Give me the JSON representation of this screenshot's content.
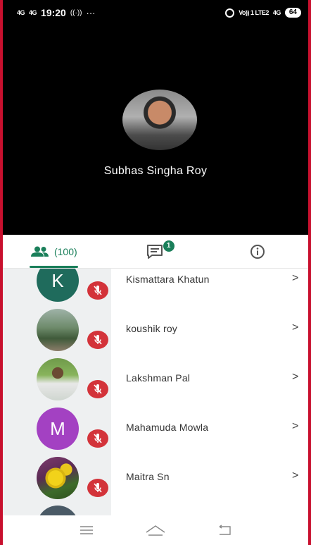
{
  "status_bar": {
    "signal_1": "4G",
    "signal_2": "4G",
    "time": "19:20",
    "extra": "···",
    "right_carrier": "Vo)) 1 LTE2",
    "right_net": "4G",
    "battery": "64"
  },
  "speaker": {
    "name": "Subhas Singha Roy"
  },
  "tabs": {
    "participants_count": "(100)",
    "chat_badge": "1"
  },
  "participants": [
    {
      "name": "Kismattara Khatun",
      "avatar_type": "letter",
      "letter": "K",
      "avatar_color": "#1f6b5c"
    },
    {
      "name": "koushik roy",
      "avatar_type": "photo"
    },
    {
      "name": "Lakshman Pal",
      "avatar_type": "photo"
    },
    {
      "name": "Mahamuda Mowla",
      "avatar_type": "letter",
      "letter": "M",
      "avatar_color": "#a341c2"
    },
    {
      "name": "Maitra Sn",
      "avatar_type": "photo"
    }
  ],
  "colors": {
    "accent": "#1a7f5a",
    "mute": "#d3333a"
  },
  "icons": {
    "people": "people-icon",
    "chat": "chat-icon",
    "info": "info-icon",
    "chevron": "chevron-right-icon",
    "mic_off": "mic-off-icon"
  },
  "chevron_glyph": ">"
}
